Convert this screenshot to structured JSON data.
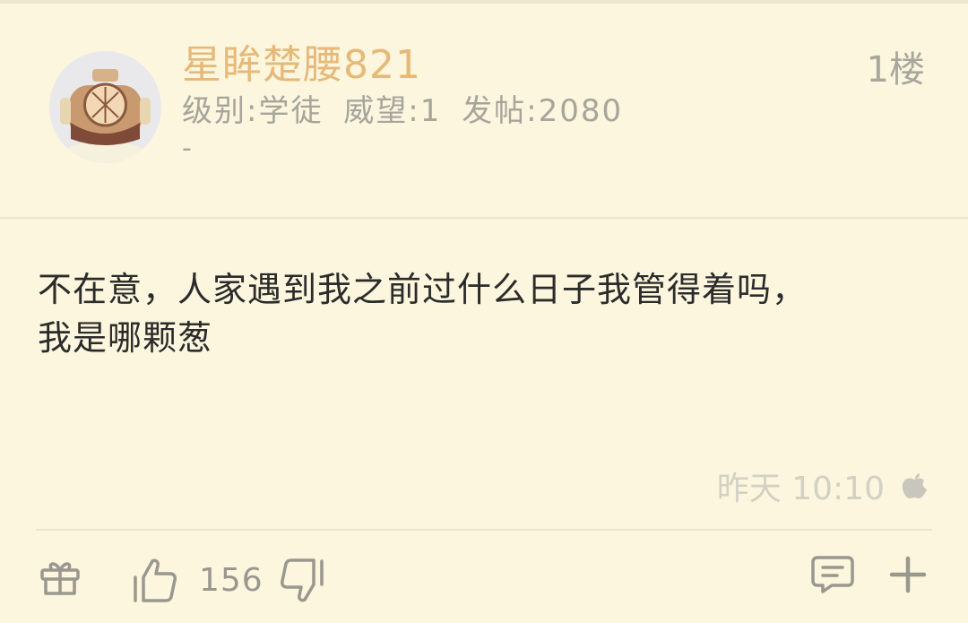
{
  "post": {
    "username": "星眸楚腰821",
    "floor": "1楼",
    "level": "级别:学徒",
    "reputation": "威望:1",
    "posts": "发帖:2080",
    "signature": "-",
    "content_line1": "不在意，人家遇到我之前过什么日子我管得着吗，",
    "content_line2": "我是哪颗葱",
    "timestamp": "昨天 10:10",
    "like_count": "156"
  },
  "colors": {
    "background": "#fbf6dd",
    "username": "#e6b979",
    "meta": "#a7a49b",
    "content": "#2b2b2b",
    "icon": "#9a978f"
  },
  "icons": {
    "device": "apple-icon",
    "gift": "gift-icon",
    "like": "thumbs-up-icon",
    "dislike": "thumbs-down-icon",
    "comment": "comment-icon",
    "add": "plus-icon"
  }
}
